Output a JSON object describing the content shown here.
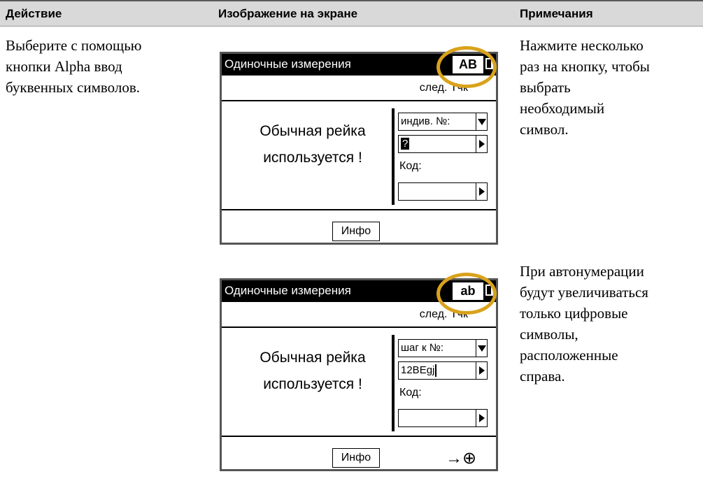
{
  "header": {
    "col1": "Действие",
    "col2": "Изображение на экране",
    "col3": "Примечания"
  },
  "row1": {
    "action": [
      "Выберите с помощью",
      "кнопки Alpha ввод",
      "буквенных символов."
    ],
    "notes": [
      "Нажмите несколько",
      "раз на кнопку, чтобы",
      "выбрать",
      "необходимый",
      "символ."
    ]
  },
  "row2": {
    "notes": [
      "При автонумерации",
      "будут увеличиваться",
      "только цифровые",
      "символы,",
      "расположенные",
      "справа."
    ]
  },
  "screen1": {
    "title": "Одиночные измерения",
    "mode": "AB",
    "next_point": "след. Тчк",
    "message_line1": "Обычная рейка",
    "message_line2": "используется !",
    "dropdown": "индив. №:",
    "input_value": "?",
    "code_label": "Код:",
    "code_value": "",
    "info_button": "Инфо"
  },
  "screen2": {
    "title": "Одиночные измерения",
    "mode": "ab",
    "next_point": "след. Тчк",
    "message_line1": "Обычная рейка",
    "message_line2": "используется !",
    "dropdown": "шаг к №:",
    "input_value": "12BEgj",
    "code_label": "Код:",
    "code_value": "",
    "info_button": "Инфо",
    "measure_icon": "→⊕"
  },
  "colors": {
    "highlight": "#d9a21c",
    "header_bg": "#d9d9d9"
  }
}
